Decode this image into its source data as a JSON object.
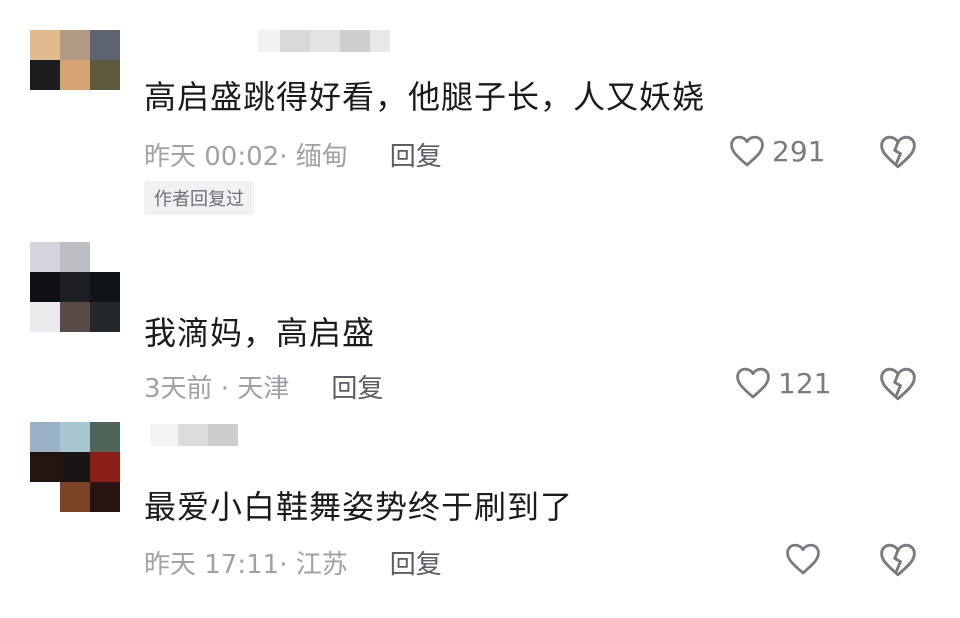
{
  "comments": [
    {
      "text": "高启盛跳得好看，他腿子长，人又妖娆",
      "meta": "昨天 00:02· 缅甸",
      "reply_label": "回复",
      "author_tag": "作者回复过",
      "likes": "291",
      "avatar_colors": [
        "#e3b98e",
        "#b09a84",
        "#5d6470",
        "#1d1d20",
        "#d5a272",
        "#5e5a3d",
        "#ffffff",
        "#ffffff",
        "#ffffff"
      ]
    },
    {
      "text": "我滴妈，高启盛",
      "meta": "3天前 · 天津",
      "reply_label": "回复",
      "likes": "121",
      "avatar_colors": [
        "#d4d4dc",
        "#bdbec4",
        "#ffffff",
        "#0e1014",
        "#1d1e22",
        "#11151a",
        "#ebebed",
        "#5a4a48",
        "#22282b"
      ]
    },
    {
      "text": "最爱小白鞋舞姿势终于刷到了",
      "meta": "昨天 17:11· 江苏",
      "reply_label": "回复",
      "likes": "",
      "avatar_colors": [
        "#9ab0c4",
        "#a7c6d1",
        "#4e6458",
        "#24140f",
        "#191515",
        "#8c1e17",
        "#ffffff",
        "#7c4426",
        "#2a1412"
      ]
    }
  ],
  "colors": {
    "text": "#1b1b1b",
    "meta": "#a0a0a6",
    "icon": "#7a7a80"
  },
  "icons": {
    "like": "heart-outline-icon",
    "dislike": "broken-heart-icon"
  }
}
